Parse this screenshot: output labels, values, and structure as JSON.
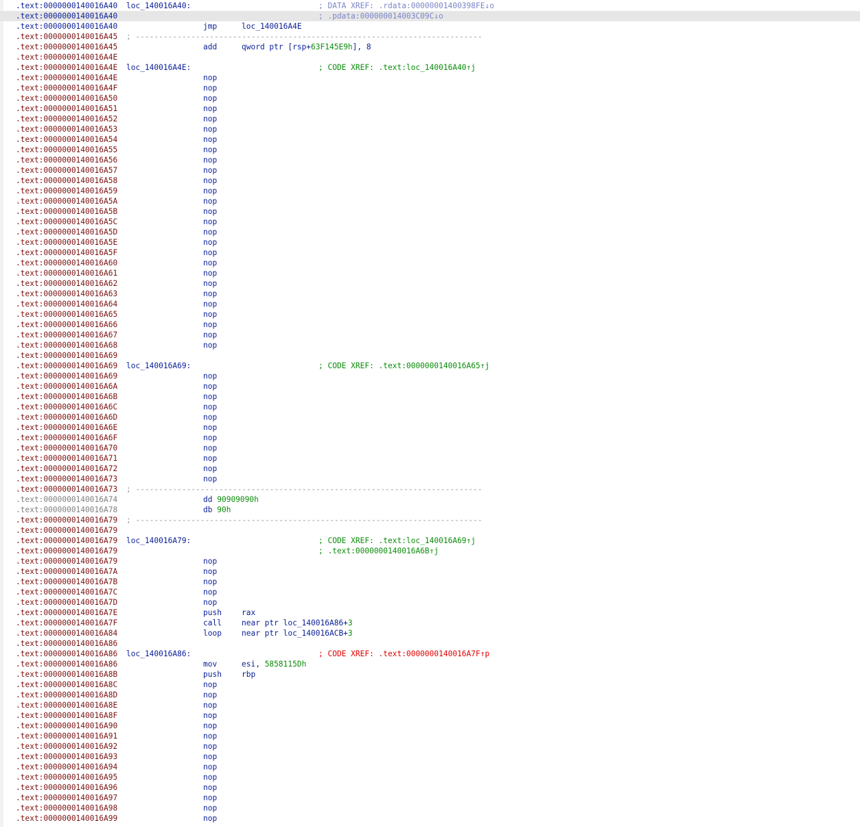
{
  "colors": {
    "address": "#7a1010",
    "address_current": "#0a1e96",
    "address_data": "#7f7f7f",
    "instruction": "#0a1e96",
    "comment": "#0a8c0a",
    "data_xref_comment": "#7b86c8",
    "call_xref_comment": "#e00000",
    "highlight": "#e6e6e6"
  },
  "lines": [
    {
      "addr": ".text:0000000140016A40",
      "addr_style": "blue",
      "label": "loc_140016A40:",
      "comment": "; DATA XREF: .rdata:00000001400398FE↓o",
      "comment_style": "dxref"
    },
    {
      "addr": ".text:0000000140016A40",
      "addr_style": "blue",
      "highlight": true,
      "comment": "; .pdata:000000014003C09C↓o",
      "comment_style": "dxref"
    },
    {
      "addr": ".text:0000000140016A40",
      "addr_style": "blue",
      "mnem": "jmp",
      "operand": "loc_140016A4E"
    },
    {
      "addr": ".text:0000000140016A45",
      "separator": "; ---------------------------------------------------------------------------"
    },
    {
      "addr": ".text:0000000140016A45",
      "mnem": "add",
      "operand": "qword ptr [rsp+",
      "operand_num": "63F145E9h",
      "operand_tail": "], 8"
    },
    {
      "addr": ".text:0000000140016A4E"
    },
    {
      "addr": ".text:0000000140016A4E",
      "label": "loc_140016A4E:",
      "comment": "; CODE XREF: .text:loc_140016A40↑j"
    },
    {
      "addr": ".text:0000000140016A4E",
      "mnem": "nop"
    },
    {
      "addr": ".text:0000000140016A4F",
      "mnem": "nop"
    },
    {
      "addr": ".text:0000000140016A50",
      "mnem": "nop"
    },
    {
      "addr": ".text:0000000140016A51",
      "mnem": "nop"
    },
    {
      "addr": ".text:0000000140016A52",
      "mnem": "nop"
    },
    {
      "addr": ".text:0000000140016A53",
      "mnem": "nop"
    },
    {
      "addr": ".text:0000000140016A54",
      "mnem": "nop"
    },
    {
      "addr": ".text:0000000140016A55",
      "mnem": "nop"
    },
    {
      "addr": ".text:0000000140016A56",
      "mnem": "nop"
    },
    {
      "addr": ".text:0000000140016A57",
      "mnem": "nop"
    },
    {
      "addr": ".text:0000000140016A58",
      "mnem": "nop"
    },
    {
      "addr": ".text:0000000140016A59",
      "mnem": "nop"
    },
    {
      "addr": ".text:0000000140016A5A",
      "mnem": "nop"
    },
    {
      "addr": ".text:0000000140016A5B",
      "mnem": "nop"
    },
    {
      "addr": ".text:0000000140016A5C",
      "mnem": "nop"
    },
    {
      "addr": ".text:0000000140016A5D",
      "mnem": "nop"
    },
    {
      "addr": ".text:0000000140016A5E",
      "mnem": "nop"
    },
    {
      "addr": ".text:0000000140016A5F",
      "mnem": "nop"
    },
    {
      "addr": ".text:0000000140016A60",
      "mnem": "nop"
    },
    {
      "addr": ".text:0000000140016A61",
      "mnem": "nop"
    },
    {
      "addr": ".text:0000000140016A62",
      "mnem": "nop"
    },
    {
      "addr": ".text:0000000140016A63",
      "mnem": "nop"
    },
    {
      "addr": ".text:0000000140016A64",
      "mnem": "nop"
    },
    {
      "addr": ".text:0000000140016A65",
      "mnem": "nop"
    },
    {
      "addr": ".text:0000000140016A66",
      "mnem": "nop"
    },
    {
      "addr": ".text:0000000140016A67",
      "mnem": "nop"
    },
    {
      "addr": ".text:0000000140016A68",
      "mnem": "nop"
    },
    {
      "addr": ".text:0000000140016A69"
    },
    {
      "addr": ".text:0000000140016A69",
      "label": "loc_140016A69:",
      "comment": "; CODE XREF: .text:0000000140016A65↑j"
    },
    {
      "addr": ".text:0000000140016A69",
      "mnem": "nop"
    },
    {
      "addr": ".text:0000000140016A6A",
      "mnem": "nop"
    },
    {
      "addr": ".text:0000000140016A6B",
      "mnem": "nop"
    },
    {
      "addr": ".text:0000000140016A6C",
      "mnem": "nop"
    },
    {
      "addr": ".text:0000000140016A6D",
      "mnem": "nop"
    },
    {
      "addr": ".text:0000000140016A6E",
      "mnem": "nop"
    },
    {
      "addr": ".text:0000000140016A6F",
      "mnem": "nop"
    },
    {
      "addr": ".text:0000000140016A70",
      "mnem": "nop"
    },
    {
      "addr": ".text:0000000140016A71",
      "mnem": "nop"
    },
    {
      "addr": ".text:0000000140016A72",
      "mnem": "nop"
    },
    {
      "addr": ".text:0000000140016A73",
      "mnem": "nop"
    },
    {
      "addr": ".text:0000000140016A73",
      "separator": "; ---------------------------------------------------------------------------"
    },
    {
      "addr": ".text:0000000140016A74",
      "addr_style": "gray",
      "mnem": "dd",
      "mnem_num": "90909090h"
    },
    {
      "addr": ".text:0000000140016A78",
      "addr_style": "gray",
      "mnem": "db",
      "mnem_num": "90h"
    },
    {
      "addr": ".text:0000000140016A79",
      "separator": "; ---------------------------------------------------------------------------"
    },
    {
      "addr": ".text:0000000140016A79"
    },
    {
      "addr": ".text:0000000140016A79",
      "label": "loc_140016A79:",
      "comment": "; CODE XREF: .text:loc_140016A69↑j"
    },
    {
      "addr": ".text:0000000140016A79",
      "comment": "; .text:0000000140016A6B↑j"
    },
    {
      "addr": ".text:0000000140016A79",
      "mnem": "nop"
    },
    {
      "addr": ".text:0000000140016A7A",
      "mnem": "nop"
    },
    {
      "addr": ".text:0000000140016A7B",
      "mnem": "nop"
    },
    {
      "addr": ".text:0000000140016A7C",
      "mnem": "nop"
    },
    {
      "addr": ".text:0000000140016A7D",
      "mnem": "nop"
    },
    {
      "addr": ".text:0000000140016A7E",
      "mnem": "push",
      "operand": "rax"
    },
    {
      "addr": ".text:0000000140016A7F",
      "mnem": "call",
      "operand": "near ptr loc_140016A86+",
      "operand_num": "3"
    },
    {
      "addr": ".text:0000000140016A84",
      "mnem": "loop",
      "operand": "near ptr loc_140016ACB+",
      "operand_num": "3"
    },
    {
      "addr": ".text:0000000140016A86"
    },
    {
      "addr": ".text:0000000140016A86",
      "label": "loc_140016A86:",
      "comment": "; CODE XREF: .text:0000000140016A7F↑p",
      "comment_style": "red"
    },
    {
      "addr": ".text:0000000140016A86",
      "mnem": "mov",
      "operand": "esi, ",
      "operand_num": "5858115Dh"
    },
    {
      "addr": ".text:0000000140016A8B",
      "mnem": "push",
      "operand": "rbp"
    },
    {
      "addr": ".text:0000000140016A8C",
      "mnem": "nop"
    },
    {
      "addr": ".text:0000000140016A8D",
      "mnem": "nop"
    },
    {
      "addr": ".text:0000000140016A8E",
      "mnem": "nop"
    },
    {
      "addr": ".text:0000000140016A8F",
      "mnem": "nop"
    },
    {
      "addr": ".text:0000000140016A90",
      "mnem": "nop"
    },
    {
      "addr": ".text:0000000140016A91",
      "mnem": "nop"
    },
    {
      "addr": ".text:0000000140016A92",
      "mnem": "nop"
    },
    {
      "addr": ".text:0000000140016A93",
      "mnem": "nop"
    },
    {
      "addr": ".text:0000000140016A94",
      "mnem": "nop"
    },
    {
      "addr": ".text:0000000140016A95",
      "mnem": "nop"
    },
    {
      "addr": ".text:0000000140016A96",
      "mnem": "nop"
    },
    {
      "addr": ".text:0000000140016A97",
      "mnem": "nop"
    },
    {
      "addr": ".text:0000000140016A98",
      "mnem": "nop"
    },
    {
      "addr": ".text:0000000140016A99",
      "mnem": "nop"
    }
  ]
}
